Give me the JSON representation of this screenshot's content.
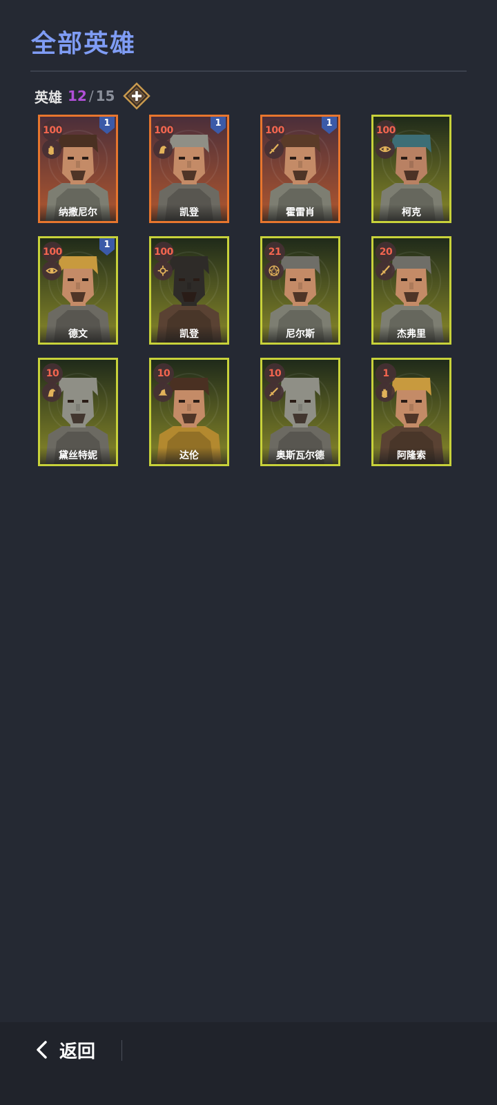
{
  "page": {
    "title": "全部英雄"
  },
  "roster": {
    "label": "英雄",
    "current": "12",
    "separator": "/",
    "max": "15",
    "add_icon": "plus-diamond-icon"
  },
  "heroes": [
    {
      "name": "纳撒尼尔",
      "level": "100",
      "stars": "1",
      "rarity": "orange",
      "class_icon": "hand-icon",
      "bg_top": "#4a2e3a",
      "bg_bottom": "#b2582f",
      "skin": "#c48b67",
      "hair": "#4a3022",
      "armor": "#7d7e72"
    },
    {
      "name": "凯登",
      "level": "100",
      "stars": "1",
      "rarity": "orange",
      "class_icon": "horse-icon",
      "bg_top": "#4a2e3a",
      "bg_bottom": "#b2582f",
      "skin": "#c48b67",
      "hair": "#8f8f86",
      "armor": "#6c6a62"
    },
    {
      "name": "霍雷肖",
      "level": "100",
      "stars": "1",
      "rarity": "orange",
      "class_icon": "dagger-icon",
      "bg_top": "#4a2e3a",
      "bg_bottom": "#b2582f",
      "skin": "#c48b67",
      "hair": "#5a3b28",
      "armor": "#7d7e72"
    },
    {
      "name": "柯克",
      "level": "100",
      "stars": "",
      "rarity": "yellow",
      "class_icon": "eye-icon",
      "bg_top": "#1f2a1a",
      "bg_bottom": "#8a8a2a",
      "skin": "#b98163",
      "hair": "#3c6e76",
      "armor": "#7d7e72"
    },
    {
      "name": "德文",
      "level": "100",
      "stars": "1",
      "rarity": "yellow",
      "class_icon": "eye-icon",
      "bg_top": "#1f2a1a",
      "bg_bottom": "#8a8a2a",
      "skin": "#c48b67",
      "hair": "#c89a3e",
      "armor": "#6c6a62"
    },
    {
      "name": "凯登",
      "level": "100",
      "stars": "",
      "rarity": "yellow",
      "class_icon": "sun-icon",
      "bg_top": "#1f2a1a",
      "bg_bottom": "#8a8a2a",
      "skin": "#2e2b28",
      "hair": "#2e2b28",
      "armor": "#5a4233"
    },
    {
      "name": "尼尔斯",
      "level": "21",
      "stars": "",
      "rarity": "yellow",
      "class_icon": "pentagram-icon",
      "bg_top": "#1f2a1a",
      "bg_bottom": "#8a8a2a",
      "skin": "#c48b67",
      "hair": "#6f6e68",
      "armor": "#7d7e72"
    },
    {
      "name": "杰弗里",
      "level": "20",
      "stars": "",
      "rarity": "yellow",
      "class_icon": "dagger-icon",
      "bg_top": "#1f2a1a",
      "bg_bottom": "#8a8a2a",
      "skin": "#c48b67",
      "hair": "#6f6e68",
      "armor": "#7d7e72"
    },
    {
      "name": "黛丝特妮",
      "level": "10",
      "stars": "",
      "rarity": "yellow",
      "class_icon": "horse-icon",
      "bg_top": "#1f2a1a",
      "bg_bottom": "#8a8a2a",
      "skin": "#8f8f86",
      "hair": "#8f8f86",
      "armor": "#6c6a62"
    },
    {
      "name": "达伦",
      "level": "10",
      "stars": "",
      "rarity": "yellow",
      "class_icon": "hat-icon",
      "bg_top": "#1f2a1a",
      "bg_bottom": "#8a8a2a",
      "skin": "#c48b67",
      "hair": "#4a3022",
      "armor": "#b3892f"
    },
    {
      "name": "奥斯瓦尔德",
      "level": "10",
      "stars": "",
      "rarity": "yellow",
      "class_icon": "sword-icon",
      "bg_top": "#1f2a1a",
      "bg_bottom": "#8a8a2a",
      "skin": "#8f8f86",
      "hair": "#8f8f86",
      "armor": "#6c6a62"
    },
    {
      "name": "阿隆索",
      "level": "1",
      "stars": "",
      "rarity": "yellow",
      "class_icon": "hand-icon",
      "bg_top": "#1f2a1a",
      "bg_bottom": "#8a8a2a",
      "skin": "#c48b67",
      "hair": "#c89a3e",
      "armor": "#5a4233"
    }
  ],
  "footer": {
    "back_label": "返回",
    "back_icon": "chevron-left-icon"
  }
}
